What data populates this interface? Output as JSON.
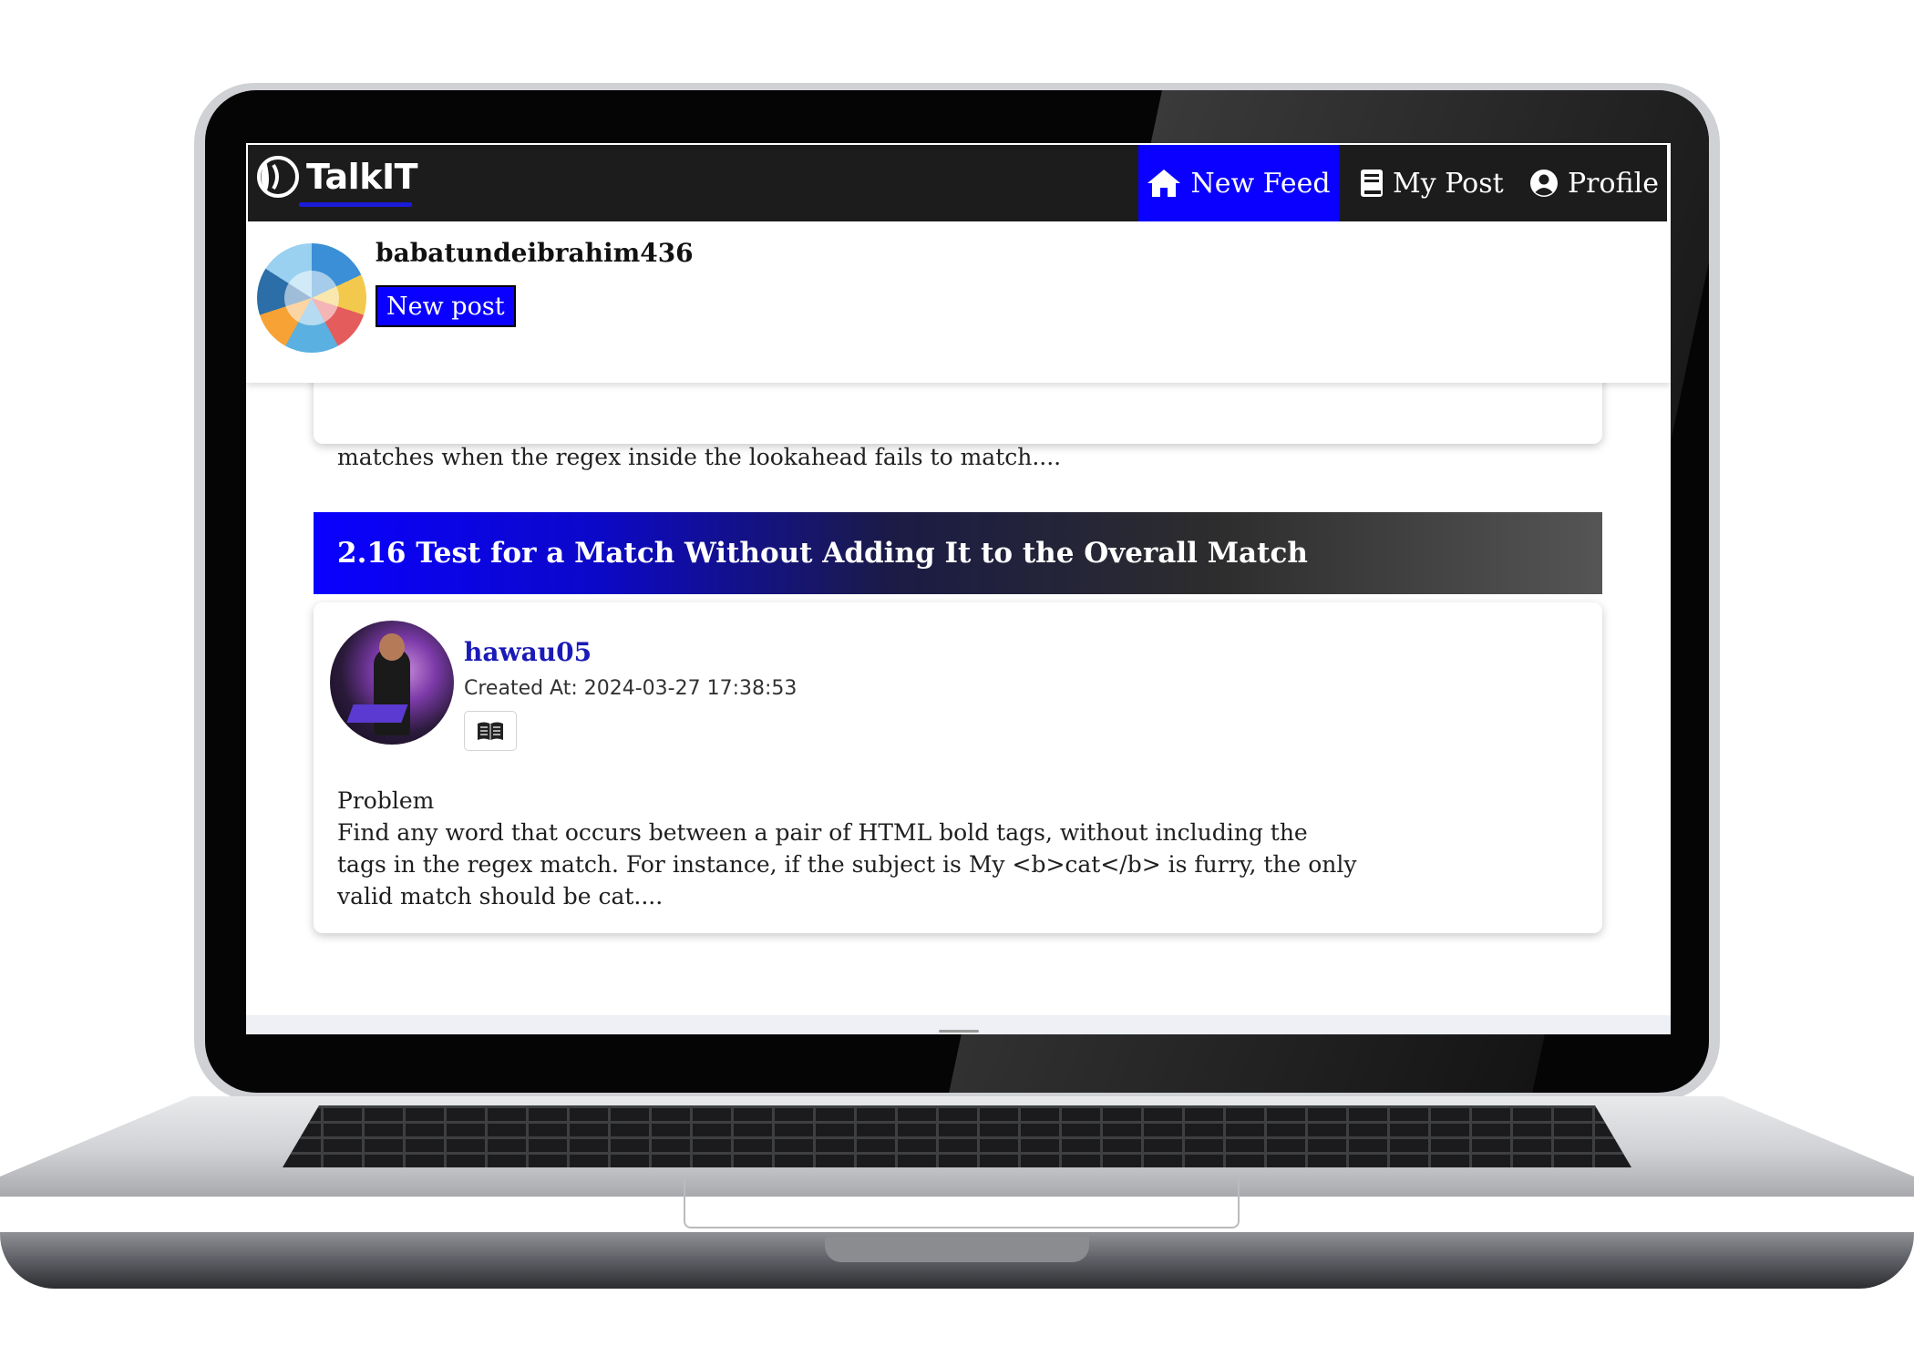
{
  "app": {
    "name": "TalkIT"
  },
  "nav": {
    "items": [
      {
        "label": "New Feed",
        "icon": "home-icon",
        "active": true
      },
      {
        "label": "My Post",
        "icon": "book-icon",
        "active": false
      },
      {
        "label": "Profile",
        "icon": "user-circle-icon",
        "active": false
      }
    ]
  },
  "user_panel": {
    "username": "babatundeibrahim436",
    "new_post_label": "New post"
  },
  "feed": {
    "previous_post_tail": "matches when the regex inside the lookahead fails to match....",
    "post": {
      "title": "2.16 Test for a Match Without Adding It to the Overall Match",
      "author": "hawau05",
      "created_at": "Created At: 2024-03-27 17:38:53",
      "read_icon": "open-book-icon",
      "body_lines": [
        "Problem",
        "Find any word that occurs between a pair of HTML bold tags, without including the",
        "tags in the regex match. For instance, if the subject is My <b>cat</b> is furry, the only",
        "valid match should be cat...."
      ]
    }
  },
  "colors": {
    "accent": "#0a00ff",
    "navbar": "#1c1c1c",
    "link": "#1a1ab8"
  }
}
